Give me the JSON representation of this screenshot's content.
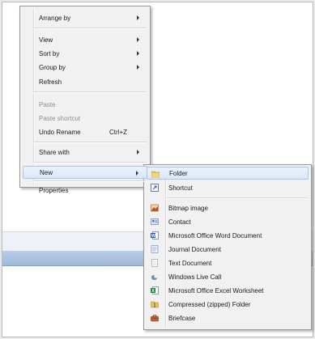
{
  "context_menu": {
    "items": [
      {
        "label": "Arrange by"
      },
      {
        "label": "View"
      },
      {
        "label": "Sort by"
      },
      {
        "label": "Group by"
      },
      {
        "label": "Refresh"
      },
      {
        "label": "Paste"
      },
      {
        "label": "Paste shortcut"
      },
      {
        "label": "Undo Rename",
        "shortcut": "Ctrl+Z"
      },
      {
        "label": "Share with"
      },
      {
        "label": "New"
      },
      {
        "label": "Properties"
      }
    ]
  },
  "new_submenu": {
    "items": [
      {
        "label": "Folder",
        "icon": "folder-icon"
      },
      {
        "label": "Shortcut",
        "icon": "shortcut-icon"
      },
      {
        "label": "Bitmap image",
        "icon": "bitmap-icon"
      },
      {
        "label": "Contact",
        "icon": "contact-icon"
      },
      {
        "label": "Microsoft Office Word Document",
        "icon": "word-document-icon"
      },
      {
        "label": "Journal Document",
        "icon": "journal-document-icon"
      },
      {
        "label": "Text Document",
        "icon": "text-document-icon"
      },
      {
        "label": "Windows Live Call",
        "icon": "live-call-icon"
      },
      {
        "label": "Microsoft Office Excel Worksheet",
        "icon": "excel-worksheet-icon"
      },
      {
        "label": "Compressed (zipped) Folder",
        "icon": "zipped-folder-icon"
      },
      {
        "label": "Briefcase",
        "icon": "briefcase-icon"
      }
    ]
  }
}
